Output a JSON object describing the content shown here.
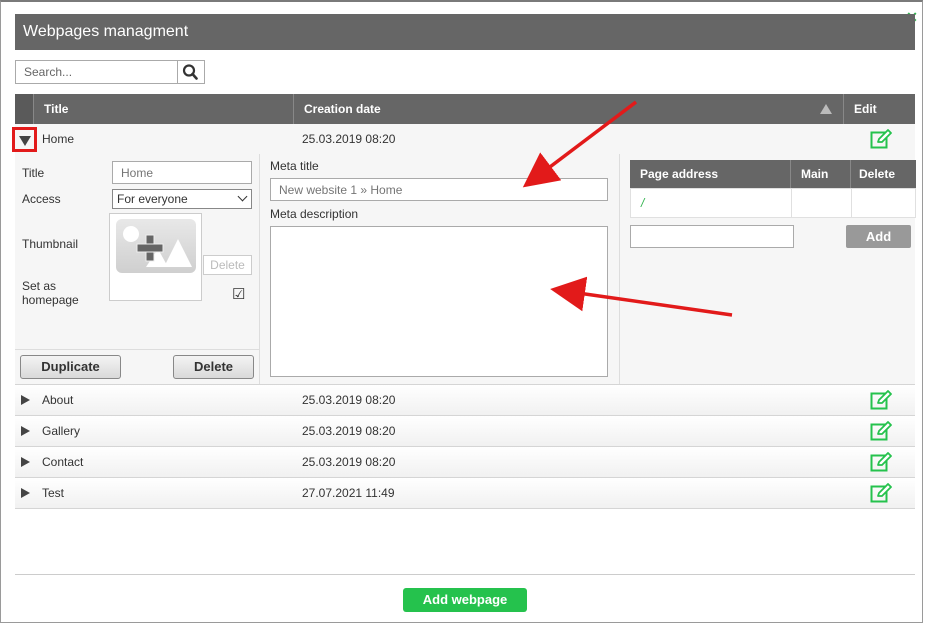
{
  "window": {
    "title": "Webpages managment",
    "close_glyph": "✕"
  },
  "search": {
    "placeholder": "Search..."
  },
  "table": {
    "headers": {
      "title": "Title",
      "creation_date": "Creation date",
      "edit": "Edit"
    },
    "rows": [
      {
        "name": "Home",
        "date": "25.03.2019 08:20",
        "expanded": true
      },
      {
        "name": "About",
        "date": "25.03.2019 08:20",
        "expanded": false
      },
      {
        "name": "Gallery",
        "date": "25.03.2019 08:20",
        "expanded": false
      },
      {
        "name": "Contact",
        "date": "25.03.2019 08:20",
        "expanded": false
      },
      {
        "name": "Test",
        "date": "27.07.2021 11:49",
        "expanded": false
      }
    ]
  },
  "details": {
    "title_label": "Title",
    "title_placeholder": "Home",
    "access_label": "Access",
    "access_value": "For everyone",
    "thumbnail_label": "Thumbnail",
    "thumbnail_delete": "Delete",
    "homepage_label": "Set as homepage",
    "homepage_checked": true,
    "duplicate_button": "Duplicate",
    "delete_button": "Delete",
    "meta_title_label": "Meta title",
    "meta_title_placeholder": "New website 1 » Home",
    "meta_description_label": "Meta description",
    "page_address": {
      "headers": {
        "address": "Page address",
        "main": "Main",
        "delete": "Delete"
      },
      "rows": [
        {
          "address": "/"
        }
      ],
      "add_button": "Add"
    }
  },
  "footer": {
    "add_webpage_button": "Add webpage"
  },
  "colors": {
    "header_bg": "#666666",
    "accent_green": "#25c24d",
    "annotation_red": "#e21a1a"
  },
  "icons": {
    "search": "search-icon",
    "edit": "edit-icon",
    "close": "close-icon",
    "thumbnail": "image-add-icon"
  }
}
